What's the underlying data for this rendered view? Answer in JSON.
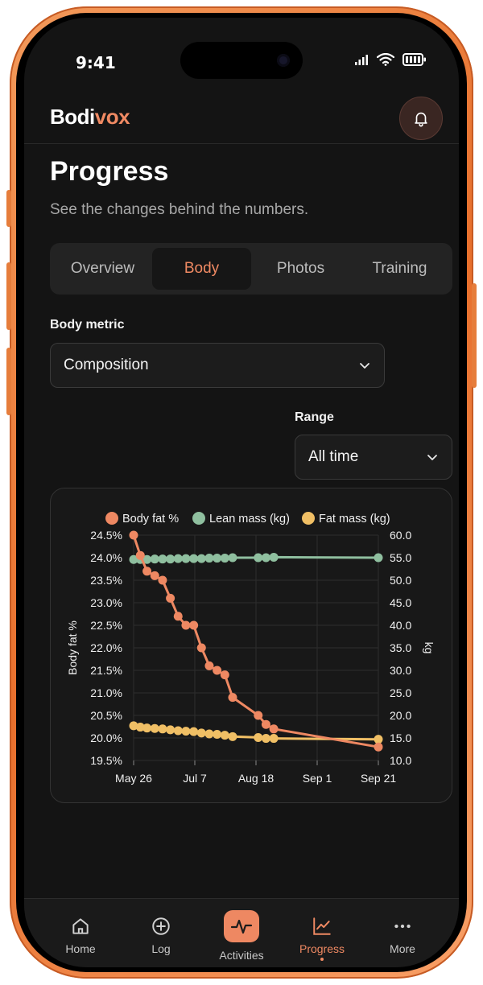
{
  "status": {
    "time": "9:41"
  },
  "header": {
    "logo_part1": "Bodi",
    "logo_part2": "vox"
  },
  "page": {
    "title": "Progress",
    "subtitle": "See the changes behind the numbers."
  },
  "tabs": [
    {
      "label": "Overview",
      "active": false
    },
    {
      "label": "Body",
      "active": true
    },
    {
      "label": "Photos",
      "active": false
    },
    {
      "label": "Training",
      "active": false
    }
  ],
  "metric": {
    "label": "Body metric",
    "value": "Composition"
  },
  "range": {
    "label": "Range",
    "value": "All time"
  },
  "colors": {
    "accent": "#f08a63",
    "body_fat": "#ee8862",
    "lean_mass": "#8fbf9f",
    "fat_mass": "#f0bf65"
  },
  "chart_data": {
    "type": "line",
    "legend_position": "top",
    "grid": true,
    "x_tick_labels": [
      "May 26",
      "Jul 7",
      "Aug 18",
      "Sep 1",
      "Sep 21"
    ],
    "ylabel_left": "Body fat %",
    "ylabel_right": "kg",
    "ylim_left": [
      19.5,
      24.5
    ],
    "ylim_right": [
      10.0,
      60.0
    ],
    "y_ticks_left": [
      "24.5%",
      "24.0%",
      "23.5%",
      "23.0%",
      "22.5%",
      "22.0%",
      "21.5%",
      "21.0%",
      "20.5%",
      "20.0%",
      "19.5%"
    ],
    "y_ticks_right": [
      "60.0",
      "55.0",
      "50.0",
      "45.0",
      "40.0",
      "35.0",
      "30.0",
      "25.0",
      "20.0",
      "15.0",
      "10.0"
    ],
    "series": [
      {
        "name": "Body fat %",
        "axis": "left",
        "color": "#ee8862",
        "x": [
          "2025-05-26",
          "2025-06-01",
          "2025-06-07",
          "2025-06-14",
          "2025-06-21",
          "2025-06-28",
          "2025-07-05",
          "2025-07-12",
          "2025-07-19",
          "2025-07-26",
          "2025-08-02",
          "2025-08-09",
          "2025-08-16",
          "2025-08-23",
          "2025-09-15",
          "2025-09-22",
          "2025-09-29",
          "2026-01-01"
        ],
        "values": [
          24.5,
          24.05,
          23.7,
          23.6,
          23.5,
          23.1,
          22.7,
          22.5,
          22.5,
          22.0,
          21.6,
          21.5,
          21.4,
          20.9,
          20.5,
          20.3,
          20.2,
          19.8
        ]
      },
      {
        "name": "Lean mass (kg)",
        "axis": "right",
        "color": "#8fbf9f",
        "x": [
          "2025-05-26",
          "2025-06-01",
          "2025-06-07",
          "2025-06-14",
          "2025-06-21",
          "2025-06-28",
          "2025-07-05",
          "2025-07-12",
          "2025-07-19",
          "2025-07-26",
          "2025-08-02",
          "2025-08-09",
          "2025-08-16",
          "2025-08-23",
          "2025-09-15",
          "2025-09-22",
          "2025-09-29",
          "2026-01-01"
        ],
        "values": [
          54.6,
          54.6,
          54.6,
          54.7,
          54.7,
          54.7,
          54.8,
          54.8,
          54.8,
          54.8,
          54.9,
          54.9,
          54.9,
          55.0,
          55.0,
          55.0,
          55.1,
          55.0
        ]
      },
      {
        "name": "Fat mass (kg)",
        "axis": "right",
        "color": "#f0bf65",
        "x": [
          "2025-05-26",
          "2025-06-01",
          "2025-06-07",
          "2025-06-14",
          "2025-06-21",
          "2025-06-28",
          "2025-07-05",
          "2025-07-12",
          "2025-07-19",
          "2025-07-26",
          "2025-08-02",
          "2025-08-09",
          "2025-08-16",
          "2025-08-23",
          "2025-09-15",
          "2025-09-22",
          "2025-09-29",
          "2026-01-01"
        ],
        "values": [
          17.7,
          17.4,
          17.2,
          17.1,
          17.0,
          16.8,
          16.6,
          16.5,
          16.4,
          16.1,
          15.9,
          15.8,
          15.6,
          15.3,
          15.1,
          14.9,
          14.9,
          14.7
        ]
      }
    ]
  },
  "nav": [
    {
      "label": "Home",
      "icon": "home-icon"
    },
    {
      "label": "Log",
      "icon": "plus-circle-icon"
    },
    {
      "label": "Activities",
      "icon": "pulse-icon"
    },
    {
      "label": "Progress",
      "icon": "chart-icon"
    },
    {
      "label": "More",
      "icon": "more-icon"
    }
  ]
}
